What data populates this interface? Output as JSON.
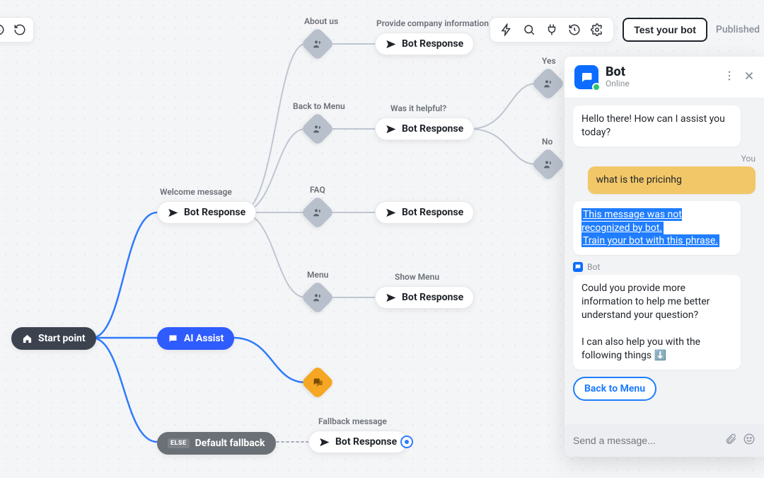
{
  "toolbar": {
    "test_label": "Test your bot",
    "status": "Published"
  },
  "flow": {
    "start_label": "Start point",
    "welcome_title": "Welcome message",
    "welcome_label": "Bot Response",
    "ai_assist_label": "AI Assist",
    "default_fallback_badge": "ELSE",
    "default_fallback_label": "Default fallback",
    "fallback_title": "Fallback message",
    "fallback_label": "Bot Response",
    "about_title": "About us",
    "about_resp_title": "Provide company information",
    "about_resp_label": "Bot Response",
    "back_title": "Back to Menu",
    "helpful_title": "Was it helpful?",
    "helpful_label": "Bot Response",
    "yes_title": "Yes",
    "no_title": "No",
    "faq_title": "FAQ",
    "faq_resp_label": "Bot Response",
    "menu_title": "Menu",
    "menu_resp_title": "Show Menu",
    "menu_resp_label": "Bot Response"
  },
  "chat": {
    "name": "Bot",
    "status": "Online",
    "greeting": "Hello there! How can I assist you today?",
    "user_label": "You",
    "user_msg": "what is the pricinhg",
    "alert_line1": "This message was not recognized by bot.",
    "alert_line2": "Train your bot with this phrase.",
    "sender_bot": "Bot",
    "reply_line1": "Could you provide more information to help me better understand your question?",
    "reply_line2": "I can also help you with the following things ⬇️",
    "quick_reply": "Back to Menu",
    "input_placeholder": "Send a message..."
  }
}
